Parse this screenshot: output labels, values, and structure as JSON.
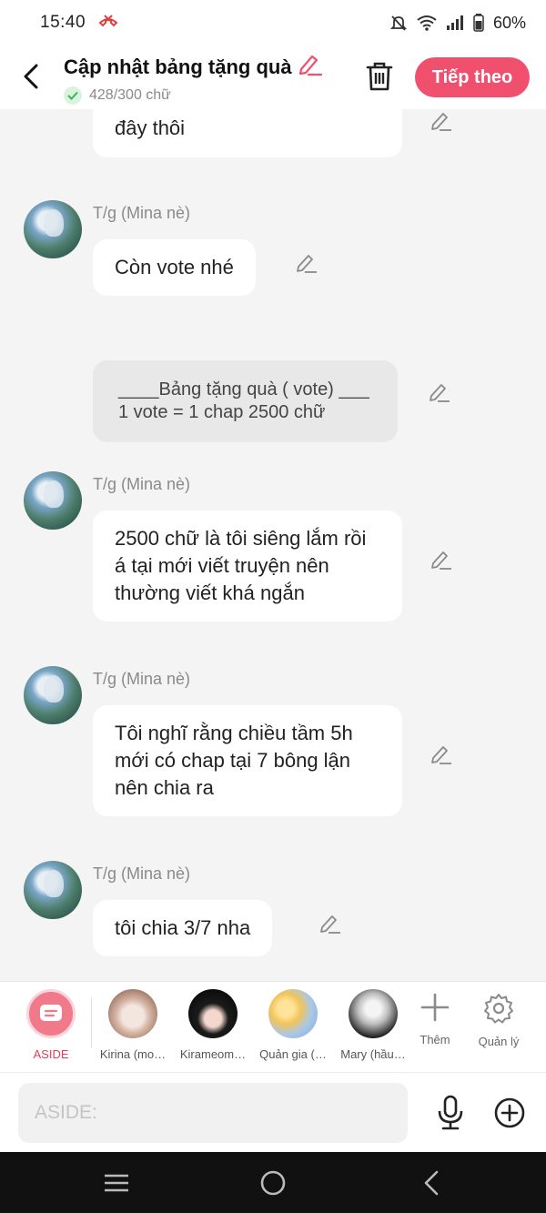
{
  "status_bar": {
    "time": "15:40",
    "battery": "60%"
  },
  "header": {
    "title": "Cập nhật bảng tặng quà",
    "word_count": "428/300 chữ",
    "next_label": "Tiếp theo"
  },
  "messages": [
    {
      "text": "đây thôi"
    },
    {
      "author": "T/g (Mina nè)",
      "text": "Còn vote nhé"
    },
    {
      "text_line1": "____Bảng tặng quà ( vote) ___",
      "text_line2": "1 vote = 1 chap 2500 chữ"
    },
    {
      "author": "T/g (Mina nè)",
      "text": "2500 chữ là tôi siêng lắm rồi á tại mới viết truyện nên thường viết khá ngắn"
    },
    {
      "author": "T/g (Mina nè)",
      "text": "Tôi nghĩ rằng chiều tầm 5h mới có chap tại 7 bông lận nên chia ra"
    },
    {
      "author": "T/g (Mina nè)",
      "text": "tôi chia 3/7 nha"
    }
  ],
  "characters": [
    {
      "label": "ASIDE"
    },
    {
      "label": "Kirina (mo…"
    },
    {
      "label": "Kirameom…"
    },
    {
      "label": "Quản gia (…"
    },
    {
      "label": "Mary (hầu…"
    }
  ],
  "tools": {
    "add_label": "Thêm",
    "manage_label": "Quản lý"
  },
  "input": {
    "placeholder": "ASIDE:"
  },
  "colors": {
    "accent": "#f0506e",
    "background": "#f4f4f4",
    "bubble": "#ffffff"
  }
}
